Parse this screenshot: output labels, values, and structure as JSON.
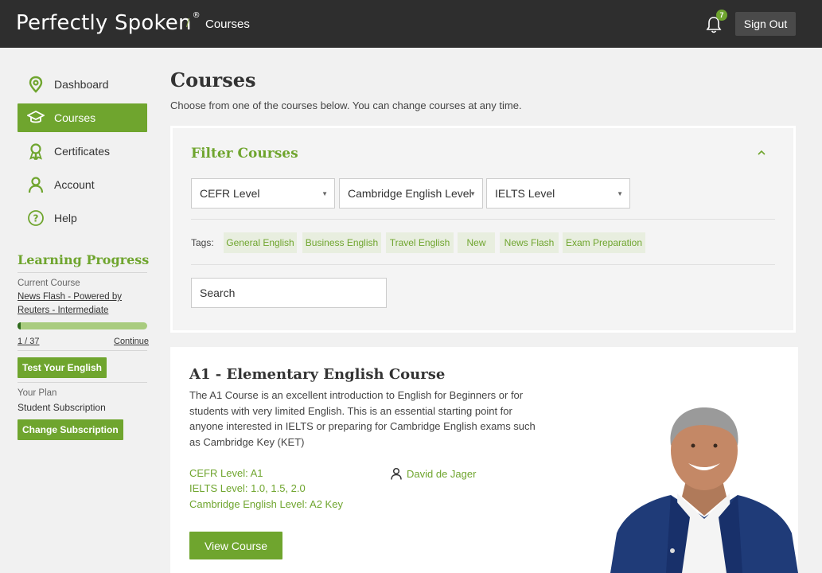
{
  "header": {
    "logo_text": "Perfectly Spoken",
    "logo_mark": "®",
    "breadcrumb_sep": "/",
    "breadcrumb_current": "Courses",
    "notification_count": "7",
    "signout_label": "Sign Out"
  },
  "sidebar": {
    "items": [
      {
        "label": "Dashboard",
        "icon": "map-pin-icon"
      },
      {
        "label": "Courses",
        "icon": "graduation-cap-icon"
      },
      {
        "label": "Certificates",
        "icon": "award-icon"
      },
      {
        "label": "Account",
        "icon": "user-icon"
      },
      {
        "label": "Help",
        "icon": "help-circle-icon"
      }
    ],
    "active_index": 1,
    "progress": {
      "title": "Learning Progress",
      "current_course_label": "Current Course",
      "current_course_name": "News Flash - Powered by Reuters - Intermediate",
      "count": "1 / 37",
      "progress_fraction": 0.027,
      "continue_label": "Continue",
      "test_button": "Test Your English",
      "plan_label": "Your Plan",
      "plan_name": "Student Subscription",
      "change_button": "Change Subscription"
    }
  },
  "main": {
    "title": "Courses",
    "subtitle": "Choose from one of the courses below. You can change courses at any time.",
    "filter": {
      "title": "Filter Courses",
      "caret": "^",
      "selects": [
        "CEFR Level",
        "Cambridge English Level",
        "IELTS Level"
      ],
      "tags_label": "Tags:",
      "tags": [
        "General English",
        "Business English",
        "Travel English",
        "New",
        "News Flash",
        "Exam Preparation"
      ],
      "search_placeholder": "Search"
    },
    "course": {
      "title": "A1 - Elementary English Course",
      "description": "The A1 Course is an excellent introduction to English for Beginners or for students with very limited English. This is an essential starting point for anyone interested in IELTS or preparing for Cambridge English exams such as Cambridge Key (KET)",
      "cefr": "CEFR Level: A1",
      "ielts": "IELTS Level: 1.0, 1.5, 2.0",
      "cambridge": "Cambridge English Level: A2 Key",
      "instructor": "David de Jager",
      "button": "View Course"
    }
  },
  "colors": {
    "brand_green": "#6fa52e",
    "header_bg": "#2e2e2e",
    "page_bg": "#f1f1f1"
  }
}
